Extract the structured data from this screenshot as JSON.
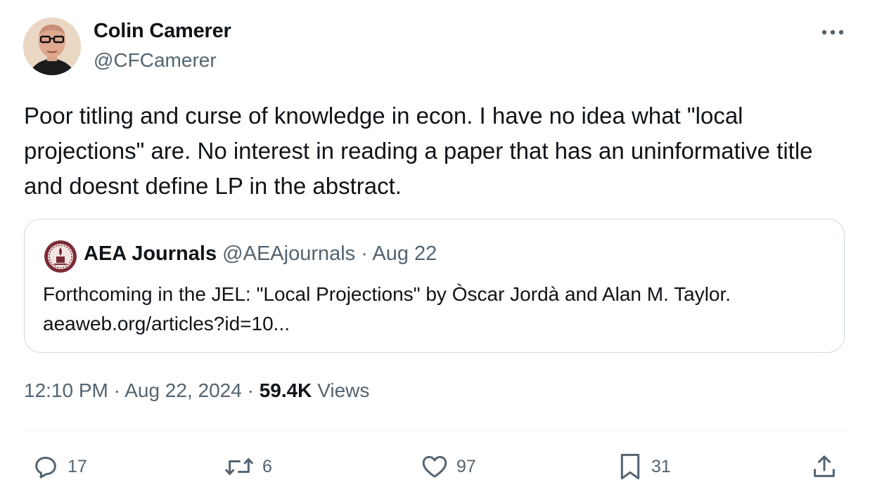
{
  "author": {
    "name": "Colin Camerer",
    "handle": "@CFCamerer"
  },
  "tweet": {
    "text": "Poor titling and curse of knowledge in econ. I have no idea what \"local projections\" are. No interest in reading a paper that has an uninformative title and doesnt define LP in the abstract."
  },
  "quote": {
    "name": "AEA Journals",
    "handle": "@AEAjournals",
    "separator": " · ",
    "date": "Aug 22",
    "text": "Forthcoming in the JEL: \"Local Projections\" by Òscar Jordà and Alan M. Taylor.",
    "link": "aeaweb.org/articles?id=10..."
  },
  "meta": {
    "time": "12:10 PM",
    "separator": " · ",
    "date": "Aug 22, 2024",
    "views_count": "59.4K",
    "views_label": "Views"
  },
  "actions": {
    "replies": "17",
    "reposts": "6",
    "likes": "97",
    "bookmarks": "31"
  },
  "icons": [
    "more-icon",
    "reply-icon",
    "repost-icon",
    "like-icon",
    "bookmark-icon",
    "share-icon"
  ],
  "colors": {
    "text": "#0f1419",
    "secondary": "#536471",
    "border": "#cfd9de"
  }
}
